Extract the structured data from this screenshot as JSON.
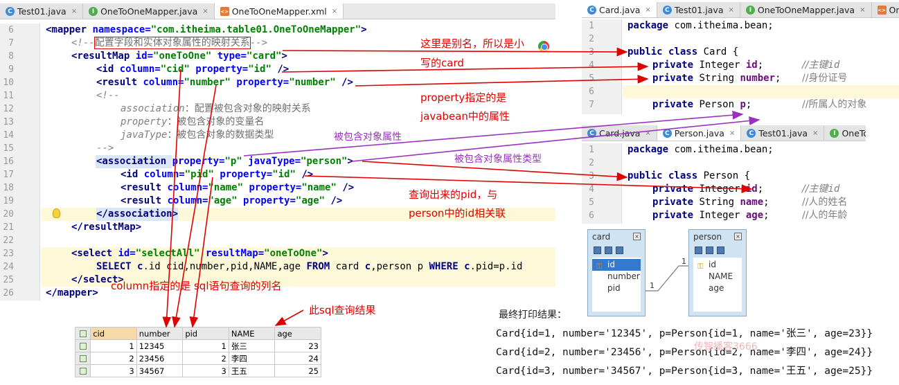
{
  "left_editor": {
    "tabs": [
      {
        "name": "Test01.java",
        "kind": "c",
        "active": false
      },
      {
        "name": "OneToOneMapper.java",
        "kind": "i",
        "active": false
      },
      {
        "name": "OneToOneMapper.xml",
        "kind": "x",
        "active": true
      }
    ],
    "line_numbers": [
      "6",
      "7",
      "8",
      "9",
      "10",
      "11",
      "12",
      "13",
      "14",
      "15",
      "16",
      "17",
      "18",
      "19",
      "20",
      "21",
      "22",
      "23",
      "24",
      "25",
      "26"
    ],
    "lines": {
      "l6_tag": "<mapper ",
      "l6_attr": "namespace=",
      "l6_val": "\"com.itheima.table01.OneToOneMapper\"",
      "l6_end": ">",
      "l7_pre": "<!--",
      "l7_zh": "配置字段和实体对象属性的映射关系",
      "l7_post": "-->",
      "l8_tag": "<resultMap ",
      "l8_a1": "id=",
      "l8_v1": "\"oneToOne\"",
      "l8_a2": " type=",
      "l8_v2": "\"card\"",
      "l8_end": ">",
      "l9_tag": "<id ",
      "l9_a1": "column=",
      "l9_v1": "\"cid\"",
      "l9_a2": " property=",
      "l9_v2": "\"id\"",
      "l9_end": " />",
      "l10_tag": "<result ",
      "l10_a1": "column=",
      "l10_v1": "\"number\"",
      "l10_a2": " property=",
      "l10_v2": "\"number\"",
      "l10_end": " />",
      "l11": "<!--",
      "l12_key": "association",
      "l12_zh": "：配置被包含对象的映射关系",
      "l13_key": "property",
      "l13_zh": "：被包含对象的变量名",
      "l14_key": "javaType",
      "l14_zh": "：被包含对象的数据类型",
      "l15": "-->",
      "l16_tag": "<association ",
      "l16_a1": "property=",
      "l16_v1": "\"p\"",
      "l16_a2": " javaType=",
      "l16_v2": "\"person\"",
      "l16_end": ">",
      "l17_tag": "<id ",
      "l17_a1": "column=",
      "l17_v1": "\"pid\"",
      "l17_a2": " property=",
      "l17_v2": "\"id\"",
      "l17_end": " />",
      "l18_tag": "<result ",
      "l18_a1": "column=",
      "l18_v1": "\"name\"",
      "l18_a2": " property=",
      "l18_v2": "\"name\"",
      "l18_end": " />",
      "l19_tag": "<result ",
      "l19_a1": "column=",
      "l19_v1": "\"age\"",
      "l19_a2": " property=",
      "l19_v2": "\"age\"",
      "l19_end": " />",
      "l20": "</association>",
      "l21": "</resultMap>",
      "l23_tag": "<select ",
      "l23_a1": "id=",
      "l23_v1": "\"selectAll\"",
      "l23_a2": " resultMap=",
      "l23_v2": "\"oneToOne\"",
      "l23_end": ">",
      "l24_sql": "SELECT ",
      "l24_c": "c",
      "l24_mid": ".id cid,number,pid,NAME,age ",
      "l24_from": "FROM",
      "l24_card": " card ",
      "l24_c2": "c",
      "l24_person": ",person p ",
      "l24_where": "WHERE ",
      "l24_c3": "c",
      "l24_tail": ".pid=p.id",
      "l25": "</select>",
      "l26": "</mapper>"
    }
  },
  "card_editor": {
    "tabs": [
      {
        "name": "Card.java",
        "kind": "c",
        "active": true
      },
      {
        "name": "Test01.java",
        "kind": "c",
        "active": false
      },
      {
        "name": "OneToOneMapper.java",
        "kind": "i",
        "active": false
      },
      {
        "name": "OneTo",
        "kind": "x",
        "active": false
      }
    ],
    "line_numbers": [
      "1",
      "2",
      "3",
      "4",
      "5",
      "6",
      "7"
    ],
    "package_kw": "package",
    "package_name": " com.itheima.bean;",
    "class_kw": "public class",
    "class_name": " Card {",
    "f1_kw": "private",
    "f1_type": " Integer ",
    "f1_name": "id",
    "f1_semi": ";",
    "f1_cmt": "//主键",
    "f1_cmt_it": "id",
    "f2_kw": "private",
    "f2_type": " String ",
    "f2_name": "number",
    "f2_semi": ";",
    "f2_cmt": "//身份证号",
    "f3_kw": "private",
    "f3_type": " Person ",
    "f3_name": "p",
    "f3_semi": ";",
    "f3_cmt": "//所属人的对象"
  },
  "person_editor": {
    "tabs": [
      {
        "name": "Card.java",
        "kind": "c",
        "active": false
      },
      {
        "name": "Person.java",
        "kind": "c",
        "active": true
      },
      {
        "name": "Test01.java",
        "kind": "c",
        "active": false
      },
      {
        "name": "OneToOne",
        "kind": "i",
        "active": false
      }
    ],
    "line_numbers": [
      "1",
      "2",
      "3",
      "4",
      "5",
      "6"
    ],
    "package_kw": "package",
    "package_name": " com.itheima.bean;",
    "class_kw": "public class",
    "class_name": " Person {",
    "f1_kw": "private",
    "f1_type": " Integer ",
    "f1_name": "id",
    "f1_semi": ";",
    "f1_cmt": "//主键",
    "f1_cmt_it": "id",
    "f2_kw": "private",
    "f2_type": " String ",
    "f2_name": "name",
    "f2_semi": ";",
    "f2_cmt": "//人的姓名",
    "f3_kw": "private",
    "f3_type": " Integer ",
    "f3_name": "age",
    "f3_semi": ";",
    "f3_cmt": "//人的年龄"
  },
  "annotations": {
    "alias_1": "这里是别名，所以是小",
    "alias_2": "写的card",
    "property_1": "property指定的是",
    "property_2": "javabean中的属性",
    "contained_prop": "被包含对象属性",
    "contained_type": "被包含对象属性类型",
    "pid_1": "查询出来的pid，与",
    "pid_2": "person中的id相关联",
    "column_note": "column指定的是 sql语句查询的列名",
    "sql_result": "此sql查询结果"
  },
  "result_grid": {
    "headers": [
      "cid",
      "number",
      "pid",
      "NAME",
      "age"
    ],
    "rows": [
      [
        "1",
        "12345",
        "1",
        "张三",
        "23"
      ],
      [
        "2",
        "23456",
        "2",
        "李四",
        "24"
      ],
      [
        "3",
        "34567",
        "3",
        "王五",
        "25"
      ]
    ]
  },
  "er_diagram": {
    "card": {
      "title": "card",
      "fields": [
        "id",
        "number",
        "pid"
      ]
    },
    "person": {
      "title": "person",
      "fields": [
        "id",
        "NAME",
        "age"
      ]
    },
    "cardinality_left": "1",
    "cardinality_right": "1"
  },
  "output": {
    "title": "最终打印结果：",
    "lines": [
      "Card{id=1, number='12345', p=Person{id=1, name='张三', age=23}}",
      "Card{id=2, number='23456', p=Person{id=2, name='李四', age=24}}",
      "Card{id=3, number='34567', p=Person{id=3, name='王五', age=25}}"
    ],
    "watermark": "传智播客3666"
  }
}
